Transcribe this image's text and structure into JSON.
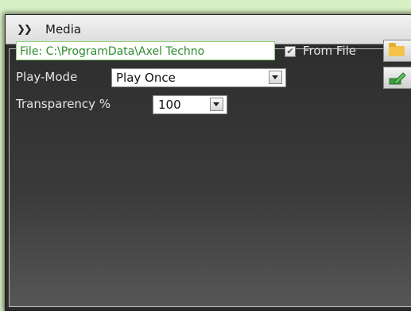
{
  "panel": {
    "title": "Media"
  },
  "file": {
    "value": "File: C:\\ProgramData\\Axel Techno",
    "from_file_label": "From File",
    "from_file_checked": true
  },
  "play_mode": {
    "label": "Play-Mode",
    "selected": "Play Once"
  },
  "transparency": {
    "label": "Transparency %",
    "selected": "100"
  },
  "icons": {
    "collapse": "double-chevron-down-icon",
    "browse": "folder-icon",
    "edit": "pencil-icon"
  },
  "colors": {
    "file_text": "#2e8b2e",
    "file_border": "#8fd17a",
    "panel_background": "#2b2b2b"
  }
}
